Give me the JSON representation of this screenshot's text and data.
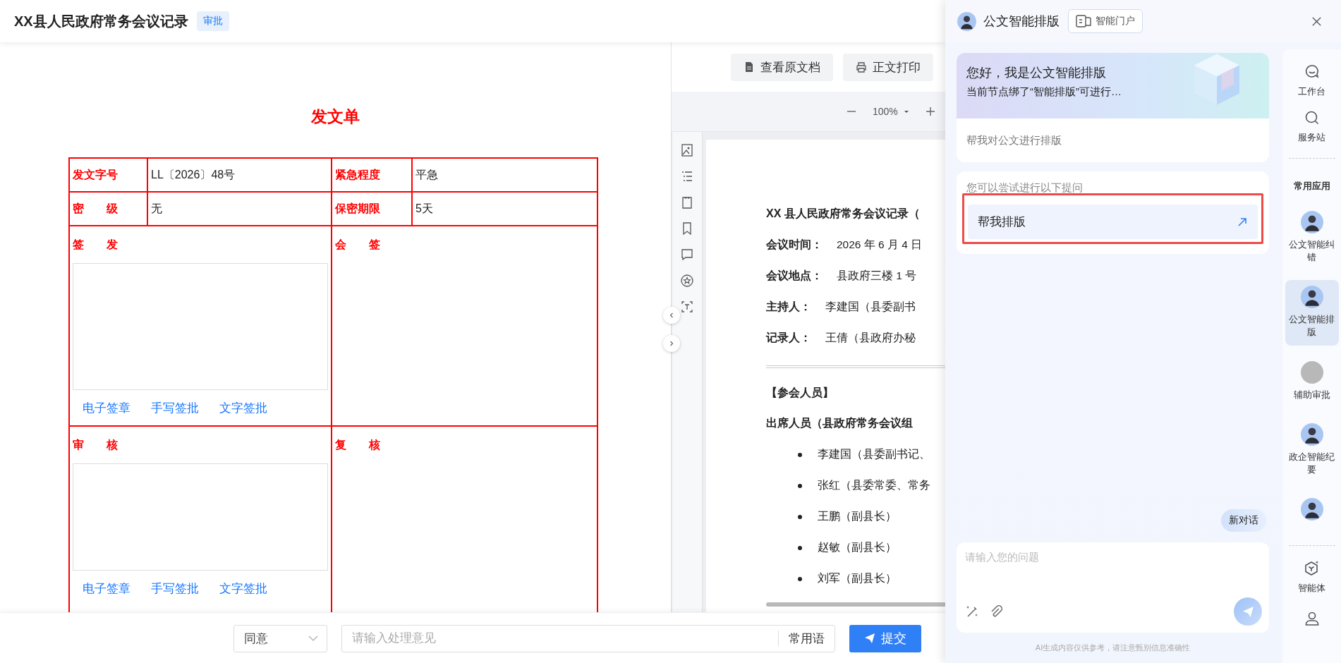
{
  "header": {
    "title": "XX县人民政府常务会议记录",
    "tag": "审批"
  },
  "form": {
    "title": "发文单",
    "fields": [
      {
        "label": "发文字号",
        "value": "LL〔2026〕48号"
      },
      {
        "label": "紧急程度",
        "value": "平急"
      },
      {
        "label": "密　　级",
        "value": "无"
      },
      {
        "label": "保密期限",
        "value": "5天"
      }
    ],
    "sign_rows": [
      {
        "left": {
          "label": "签　　发",
          "actions": [
            "电子签章",
            "手写签批",
            "文字签批"
          ]
        },
        "right": {
          "label": "会　　签"
        }
      },
      {
        "left": {
          "label": "审　　核",
          "actions": [
            "电子签章",
            "手写签批",
            "文字签批"
          ]
        },
        "right": {
          "label": "复　　核"
        }
      }
    ]
  },
  "viewer": {
    "buttons": [
      "查看原文档",
      "正文打印"
    ],
    "zoom": "100%",
    "document": {
      "title": "XX 县人民政府常务会议记录（",
      "meta": [
        {
          "label": "会议时间：",
          "value": "2026 年 6 月 4 日"
        },
        {
          "label": "会议地点：",
          "value": "县政府三楼 1 号"
        },
        {
          "label": "主持人：",
          "value": "李建国（县委副书"
        },
        {
          "label": "记录人：",
          "value": "王倩（县政府办秘"
        }
      ],
      "section": "【参会人员】",
      "subheading": "出席人员（县政府常务会议组",
      "attendees": [
        "李建国（县委副书记、",
        "张红（县委常委、常务",
        "王鹏（副县长）",
        "赵敏（副县长）",
        "刘军（副县长）"
      ]
    }
  },
  "footer_bar": {
    "decision": "同意",
    "opinion_placeholder": "请输入处理意见",
    "phrases_button": "常用语",
    "submit_button": "提交"
  },
  "assistant": {
    "title": "公文智能排版",
    "portal_button": "智能门户",
    "greeting": {
      "title": "您好，我是公文智能排版",
      "subtitle": "当前节点绑了“智能排版”可进行…",
      "prompt": "帮我对公文进行排版"
    },
    "suggestions_heading": "您可以尝试进行以下提问",
    "suggestions": [
      {
        "text": "帮我排版",
        "highlighted": true
      }
    ],
    "new_chat_button": "新对话",
    "input_placeholder": "请输入您的问题",
    "disclaimer": "AI生成内容仅供参考，请注意甄别信息准确性"
  },
  "rail": {
    "top_items": [
      "工作台",
      "服务站"
    ],
    "apps_heading": "常用应用",
    "apps": [
      {
        "label": "公文智能纠错",
        "kind": "avatar",
        "selected": false
      },
      {
        "label": "公文智能排版",
        "kind": "avatar",
        "selected": true
      },
      {
        "label": "辅助审批",
        "kind": "placeholder",
        "selected": false
      },
      {
        "label": "政企智能纪要",
        "kind": "avatar",
        "selected": false
      },
      {
        "kind": "avatar",
        "selected": false
      }
    ],
    "agent": "智能体"
  }
}
